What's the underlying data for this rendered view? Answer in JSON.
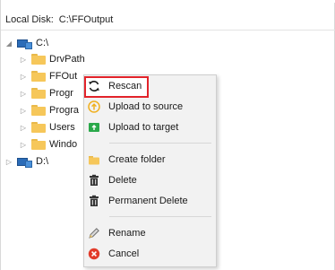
{
  "path": {
    "label": "Local Disk:",
    "value": "C:\\FFOutput"
  },
  "tree": {
    "drive_c": "C:\\",
    "children": [
      "DrvPath",
      "FFOut",
      "Progr",
      "Progra",
      "Users",
      "Windo"
    ],
    "drive_d": "D:\\"
  },
  "menu": {
    "rescan": "Rescan",
    "upload_source": "Upload to source",
    "upload_target": "Upload to target",
    "create_folder": "Create folder",
    "delete": "Delete",
    "permanent_delete": "Permanent Delete",
    "rename": "Rename",
    "cancel": "Cancel"
  },
  "colors": {
    "highlight_border": "#e2232a",
    "folder": "#f6c75a",
    "upload_source_icon": "#f0b020",
    "upload_target_icon": "#2aa84a",
    "cancel_icon": "#e23b2a"
  },
  "icons": {
    "rescan": "refresh-icon",
    "upload_source": "upload-circle-icon",
    "upload_target": "upload-box-icon",
    "create_folder": "folder-icon",
    "delete": "trash-icon",
    "permanent_delete": "trash-icon",
    "rename": "pencil-icon",
    "cancel": "cancel-icon"
  }
}
